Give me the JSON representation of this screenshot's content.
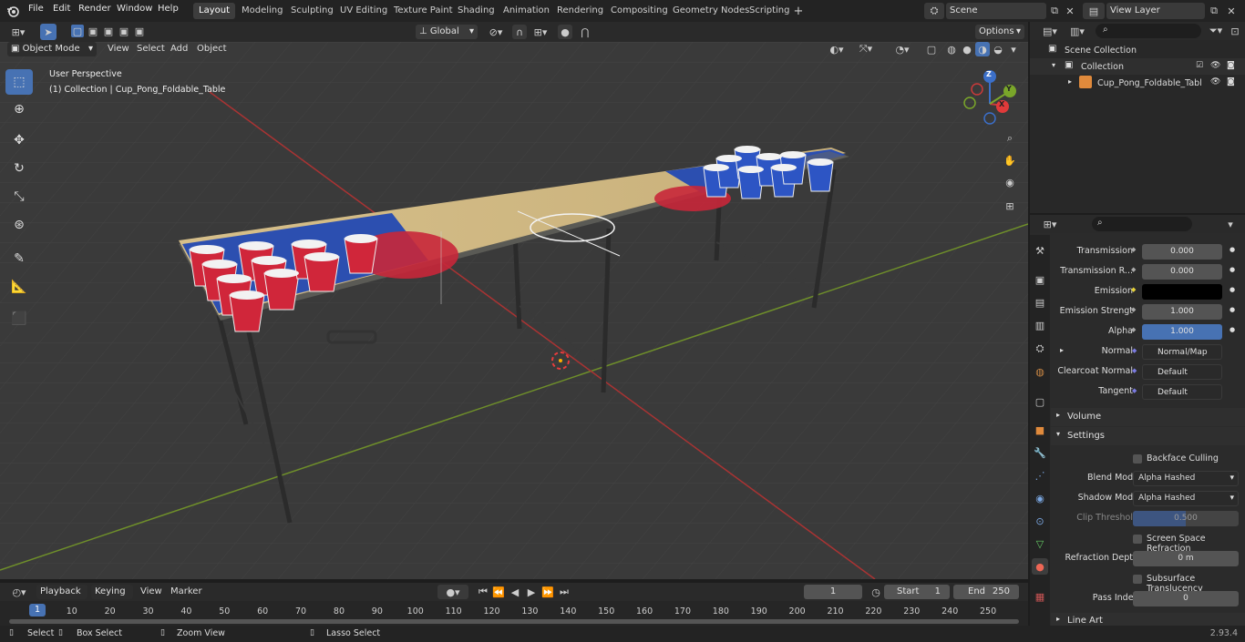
{
  "menu": [
    "File",
    "Edit",
    "Render",
    "Window",
    "Help"
  ],
  "workspaces": [
    "Layout",
    "Modeling",
    "Sculpting",
    "UV Editing",
    "Texture Paint",
    "Shading",
    "Animation",
    "Rendering",
    "Compositing",
    "Geometry Nodes",
    "Scripting"
  ],
  "active_workspace": "Layout",
  "scene": "Scene",
  "view_layer": "View Layer",
  "viewport": {
    "mode": "Object Mode",
    "menus": [
      "View",
      "Select",
      "Add",
      "Object"
    ],
    "transform_orientation": "Global",
    "options_label": "Options",
    "overlay_title": "User Perspective",
    "overlay_subtitle": "(1) Collection | Cup_Pong_Foldable_Table",
    "gizmo": {
      "x": "X",
      "y": "Y",
      "z": "Z"
    }
  },
  "outliner": {
    "items": [
      "Scene Collection",
      "Collection",
      "Cup_Pong_Foldable_Tabl"
    ]
  },
  "properties": {
    "rows": [
      {
        "label": "Transmission",
        "value": "0.000",
        "type": "num"
      },
      {
        "label": "Transmission R...",
        "value": "0.000",
        "type": "num"
      },
      {
        "label": "Emission",
        "value": "",
        "type": "color"
      },
      {
        "label": "Emission Strengt",
        "value": "1.000",
        "type": "num"
      },
      {
        "label": "Alpha",
        "value": "1.000",
        "type": "blue"
      },
      {
        "label": "Normal",
        "value": "Normal/Map",
        "type": "link"
      },
      {
        "label": "Clearcoat Normal",
        "value": "Default",
        "type": "link"
      },
      {
        "label": "Tangent",
        "value": "Default",
        "type": "link"
      }
    ],
    "sections": {
      "volume": "Volume",
      "settings": "Settings",
      "line_art": "Line Art"
    },
    "settings": {
      "backface_culling": "Backface Culling",
      "blend_mode_label": "Blend Mode",
      "blend_mode": "Alpha Hashed",
      "shadow_mode_label": "Shadow Mode",
      "shadow_mode": "Alpha Hashed",
      "clip_threshold_label": "Clip Threshold",
      "clip_threshold": "0.500",
      "screen_space_refraction": "Screen Space Refraction",
      "refraction_depth_label": "Refraction Depth",
      "refraction_depth": "0 m",
      "subsurface_translucency": "Subsurface Translucency",
      "pass_index_label": "Pass Index",
      "pass_index": "0"
    }
  },
  "timeline": {
    "menus": [
      "Playback",
      "Keying",
      "View",
      "Marker"
    ],
    "current_frame": "1",
    "start_label": "Start",
    "start": "1",
    "end_label": "End",
    "end": "250",
    "ticks": [
      "1",
      "10",
      "20",
      "30",
      "40",
      "50",
      "60",
      "70",
      "80",
      "90",
      "100",
      "110",
      "120",
      "130",
      "140",
      "150",
      "160",
      "170",
      "180",
      "190",
      "200",
      "210",
      "220",
      "230",
      "240",
      "250"
    ]
  },
  "status": {
    "select": "Select",
    "box_select": "Box Select",
    "zoom_view": "Zoom View",
    "lasso_select": "Lasso Select",
    "version": "2.93.4"
  },
  "colors": {
    "accent": "#4772b3",
    "x_axis": "#c93a3a",
    "y_axis": "#7aa62a",
    "z_axis": "#3b6fc9"
  }
}
